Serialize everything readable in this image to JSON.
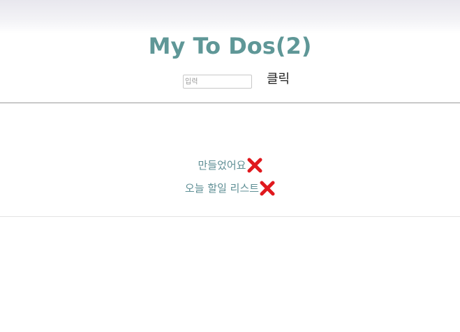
{
  "app": {
    "title": "My To Dos(2)"
  },
  "form": {
    "input_placeholder": "입력",
    "input_value": "",
    "submit_label": "클릭"
  },
  "todos": [
    {
      "text": "만들었어요",
      "delete_icon": "red-x-icon"
    },
    {
      "text": "오늘 할일 리스트",
      "delete_icon": "red-x-icon"
    }
  ],
  "colors": {
    "title": "#5f9797",
    "todo_text": "#5f8f95",
    "delete_icon": "#e0191e"
  }
}
